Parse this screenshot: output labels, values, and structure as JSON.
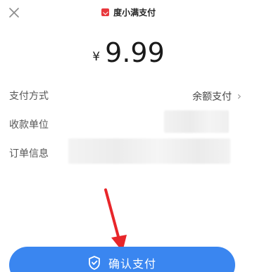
{
  "header": {
    "brand": "度小满支付",
    "close_icon": "close-icon",
    "brand_logo_icon": "duxiaoman-logo-icon"
  },
  "amount": {
    "currency": "¥",
    "value": "9.99"
  },
  "rows": {
    "method_label": "支付方式",
    "method_value": "余额支付",
    "payee_label": "收款单位",
    "order_label": "订单信息"
  },
  "confirm": {
    "label": "确认支付",
    "icon": "shield-icon"
  },
  "colors": {
    "primary": "#3a86f0",
    "brand_red": "#e8383d",
    "annotation_arrow": "#e8262a"
  }
}
